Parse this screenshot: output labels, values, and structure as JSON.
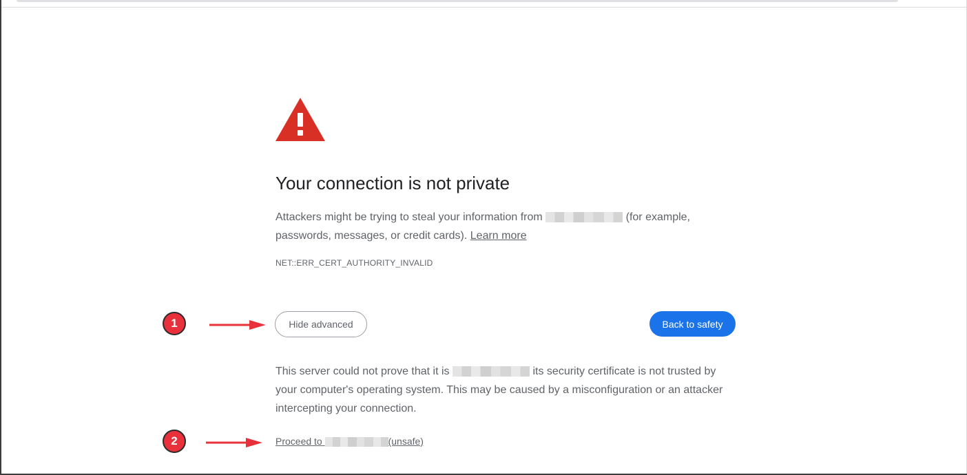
{
  "page": {
    "title": "Your connection is not private",
    "intro_before": "Attackers might be trying to steal your information from",
    "intro_after": "(for example, passwords, messages, or credit cards).",
    "learn_more": "Learn more",
    "error_code": "NET::ERR_CERT_AUTHORITY_INVALID",
    "hide_advanced_label": "Hide advanced",
    "back_to_safety_label": "Back to safety",
    "advanced_before": "This server could not prove that it is",
    "advanced_after": "its security certificate is not trusted by your computer's operating system. This may be caused by a misconfiguration or an attacker intercepting your connection.",
    "proceed_before": "Proceed to",
    "proceed_after": "(unsafe)"
  },
  "annotations": {
    "step1": "1",
    "step2": "2"
  },
  "colors": {
    "warning_red": "#d93025",
    "button_blue": "#1a73e8",
    "annotation_red": "#e8313a",
    "text_gray": "#5f6368",
    "title_dark": "#202124"
  },
  "icons": {
    "warning": "warning-triangle-icon",
    "arrow": "arrow-right-icon"
  }
}
